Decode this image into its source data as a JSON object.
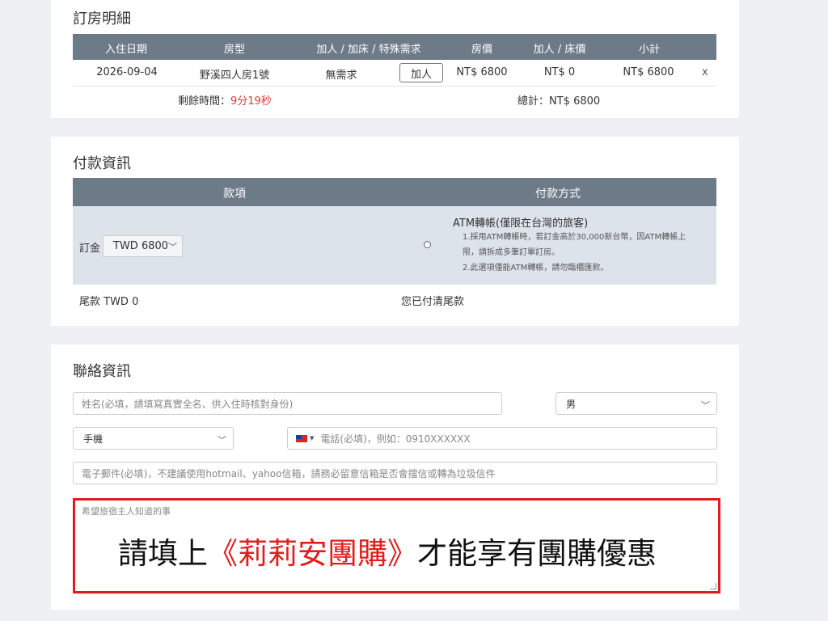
{
  "booking": {
    "title": "訂房明細",
    "headers": [
      "入住日期",
      "房型",
      "加人 / 加床 / 特殊需求",
      "房價",
      "加人 / 床價",
      "小計"
    ],
    "row": {
      "date": "2026-09-04",
      "room": "野溪四人房1號",
      "request": "無需求",
      "add_button": "加人",
      "price": "NT$ 6800",
      "extra_price": "NT$ 0",
      "subtotal": "NT$ 6800",
      "remove": "x"
    },
    "remaining_label": "剩餘時間：",
    "remaining_time": "9分19秒",
    "total": "總計：NT$ 6800"
  },
  "payment": {
    "title": "付款資訊",
    "headers": [
      "款項",
      "付款方式"
    ],
    "deposit_label": "訂金",
    "deposit_value": "TWD 6800",
    "method_title": "ATM轉帳(僅限在台灣的旅客)",
    "method_notes": [
      "1.採用ATM轉帳時，若訂金高於30,000新台幣，因ATM轉帳上",
      "限，請拆成多筆訂單訂房。",
      "2.此選項僅能ATM轉帳，請勿臨櫃匯款。"
    ],
    "balance_label": "尾款 TWD 0",
    "balance_status": "您已付清尾款"
  },
  "contact": {
    "title": "聯絡資訊",
    "name_placeholder": "姓名(必填，請填寫真實全名、供入住時核對身份)",
    "gender_value": "男",
    "phone_type": "手機",
    "phone_placeholder": "電話(必填)，例如：0910XXXXXX",
    "email_placeholder": "電子郵件(必填)，不建議使用hotmail、yahoo信箱，請務必留意信箱是否會擋信或轉為垃圾信件",
    "notes_placeholder": "希望旅宿主人知道的事",
    "notes_text_prefix": "請填上",
    "notes_text_highlight": "《莉莉安團購》",
    "notes_text_suffix": "才能享有團購優惠"
  },
  "colors": {
    "header_bg": "#6d7a87",
    "highlight_red": "#e01e1e",
    "payment_row_bg": "#dde3ea"
  }
}
